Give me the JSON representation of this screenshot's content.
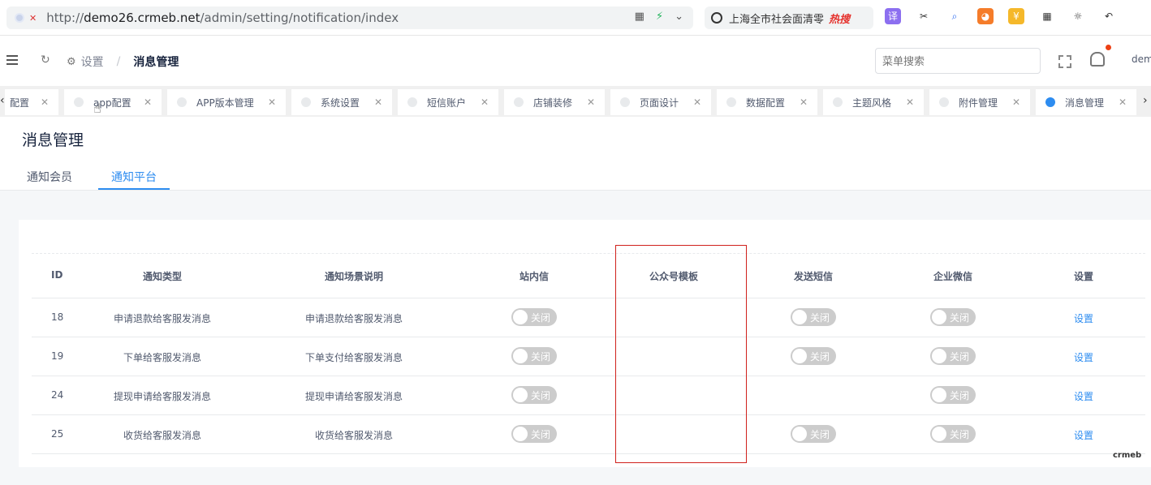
{
  "browser": {
    "url_prefix": "http://",
    "url_host": "demo26.crmeb.net",
    "url_path": "/admin/setting/notification/index",
    "search_text": "上海全市社会面清零",
    "search_hot": "热搜"
  },
  "header": {
    "breadcrumb": [
      "设置",
      "消息管理"
    ],
    "menu_search_placeholder": "菜单搜索",
    "user": "dem"
  },
  "tabs": [
    {
      "label": "配置",
      "active": false
    },
    {
      "label": "app配置",
      "active": false
    },
    {
      "label": "APP版本管理",
      "active": false
    },
    {
      "label": "系统设置",
      "active": false
    },
    {
      "label": "短信账户",
      "active": false
    },
    {
      "label": "店铺装修",
      "active": false
    },
    {
      "label": "页面设计",
      "active": false
    },
    {
      "label": "数据配置",
      "active": false
    },
    {
      "label": "主题风格",
      "active": false
    },
    {
      "label": "附件管理",
      "active": false
    },
    {
      "label": "消息管理",
      "active": true
    }
  ],
  "page": {
    "title": "消息管理",
    "subtabs": [
      "通知会员",
      "通知平台"
    ],
    "active_subtab": 1
  },
  "table": {
    "columns": [
      "ID",
      "通知类型",
      "通知场景说明",
      "站内信",
      "公众号模板",
      "发送短信",
      "企业微信",
      "设置"
    ],
    "rows": [
      {
        "id": "18",
        "type": "申请退款给客服发消息",
        "scene": "申请退款给客服发消息",
        "inbox": "关闭",
        "wechat_tpl": "",
        "sms": "关闭",
        "work_wechat": "关闭",
        "action": "设置"
      },
      {
        "id": "19",
        "type": "下单给客服发消息",
        "scene": "下单支付给客服发消息",
        "inbox": "关闭",
        "wechat_tpl": "",
        "sms": "关闭",
        "work_wechat": "关闭",
        "action": "设置"
      },
      {
        "id": "24",
        "type": "提现申请给客服发消息",
        "scene": "提现申请给客服发消息",
        "inbox": "关闭",
        "wechat_tpl": "",
        "sms": "",
        "work_wechat": "关闭",
        "action": "设置"
      },
      {
        "id": "25",
        "type": "收货给客服发消息",
        "scene": "收货给客服发消息",
        "inbox": "关闭",
        "wechat_tpl": "",
        "sms": "关闭",
        "work_wechat": "关闭",
        "action": "设置"
      }
    ]
  },
  "watermark": "crmeb",
  "colors": {
    "accent": "#2d8cf0",
    "highlight": "#d0211c",
    "switch_off": "#cccccc"
  }
}
